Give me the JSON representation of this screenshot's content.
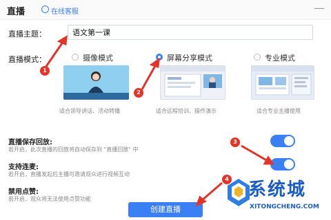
{
  "window": {
    "title": "直播",
    "service_link": "在线客服",
    "minimize_icon": "minus-icon"
  },
  "topic": {
    "label": "直播主题：",
    "value": "语文第一课"
  },
  "mode": {
    "label": "直播模式：",
    "options": [
      {
        "label": "摄像模式",
        "desc": "适合领导讲话、活动转播",
        "selected": false
      },
      {
        "label": "屏幕分享模式",
        "desc": "适合远程培训、操作演示",
        "selected": true
      },
      {
        "label": "专业模式",
        "desc": "适合专业主播使用",
        "selected": false
      }
    ]
  },
  "settings": [
    {
      "title": "直播保存回放:",
      "desc": "若开启，此次直播的回放将自动保存到 \"直播回放\" 中",
      "enabled": true
    },
    {
      "title": "支持连麦:",
      "desc": "若开启，直播发起后主播可邀请观众进行视频互动",
      "enabled": true
    },
    {
      "title": "禁用点赞:",
      "desc": "若开启，观众将无法使用点赞功能",
      "enabled": false
    }
  ],
  "create_button": "创建直播",
  "markers": [
    "1",
    "2",
    "3",
    "4"
  ],
  "watermark": {
    "text": "系统城",
    "sub": "XITONGCHENG.COM"
  },
  "colors": {
    "accent": "#3b7ff5",
    "annotation": "#e53327",
    "watermark": "#1b5cc4"
  }
}
